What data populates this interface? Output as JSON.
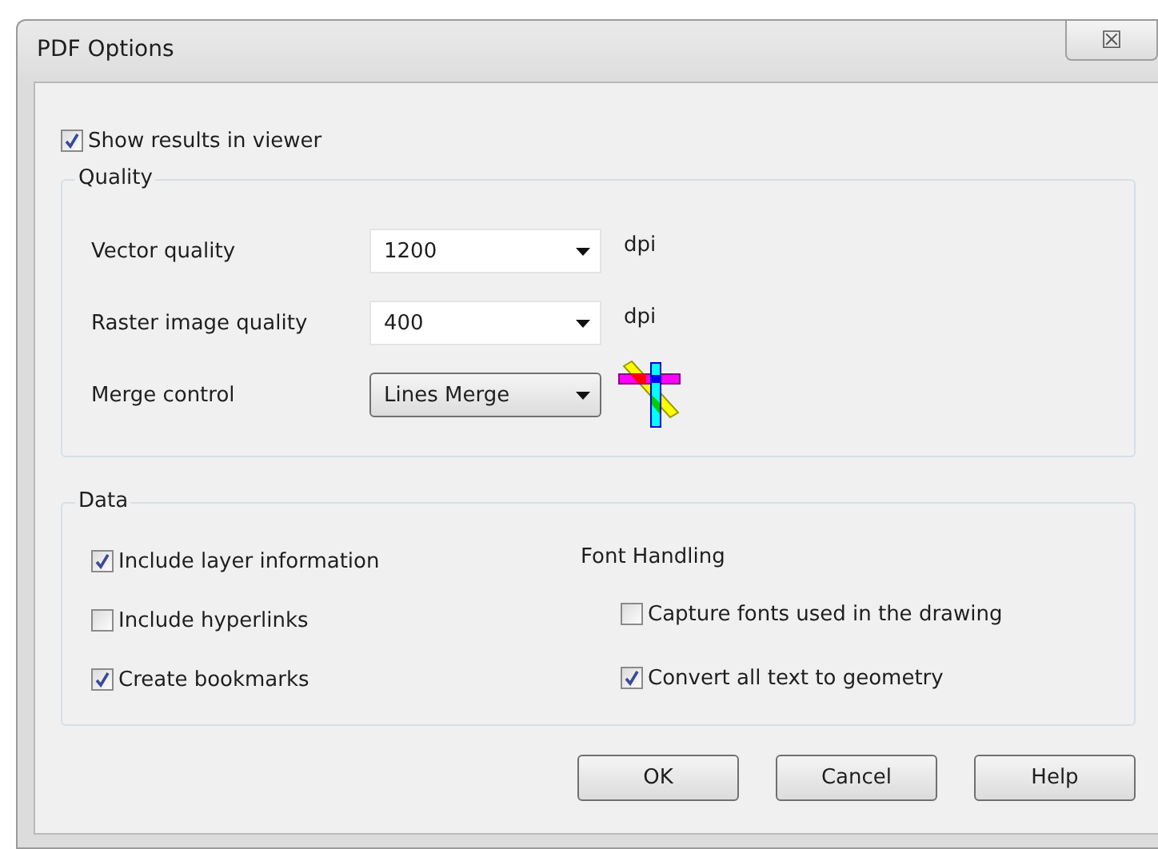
{
  "window": {
    "title": "PDF Options",
    "close": "☒"
  },
  "show_results": {
    "label": "Show results in viewer",
    "checked": true
  },
  "quality": {
    "title": "Quality",
    "rows": [
      {
        "kind": "editable",
        "label": "Vector quality",
        "value": "1200",
        "unit": "dpi"
      },
      {
        "kind": "editable",
        "label": "Raster image quality",
        "value": "400",
        "unit": "dpi"
      },
      {
        "kind": "list",
        "label": "Merge control",
        "value": "Lines Merge"
      }
    ]
  },
  "data": {
    "title": "Data",
    "options": [
      {
        "label": "Include layer information",
        "checked": true
      },
      {
        "label": "Include hyperlinks",
        "checked": false
      },
      {
        "label": "Create bookmarks",
        "checked": true
      }
    ],
    "font_handling": {
      "title": "Font Handling",
      "options": [
        {
          "label": "Capture fonts used in the drawing",
          "checked": false
        },
        {
          "label": "Convert all text to geometry",
          "checked": true
        }
      ]
    }
  },
  "buttons": [
    "OK",
    "Cancel",
    "Help"
  ]
}
